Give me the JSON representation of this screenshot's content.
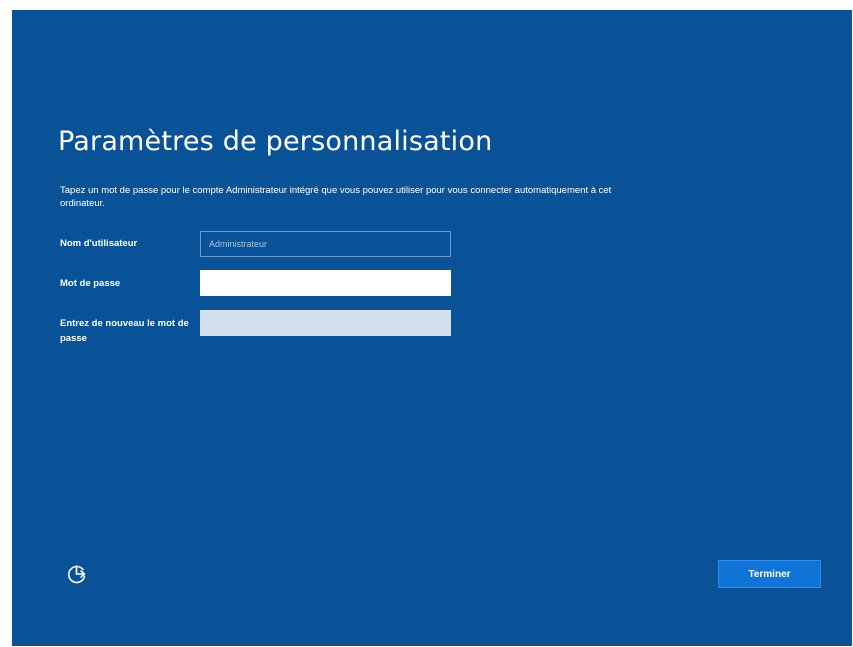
{
  "page": {
    "title": "Paramètres de personnalisation",
    "description": "Tapez un mot de passe pour le compte Administrateur intégré que vous pouvez utiliser pour vous connecter automatiquement à cet ordinateur."
  },
  "form": {
    "username": {
      "label": "Nom d'utilisateur",
      "placeholder": "Administrateur",
      "value": ""
    },
    "password": {
      "label": "Mot de passe",
      "value": ""
    },
    "confirm_password": {
      "label": "Entrez de nouveau le mot de passe",
      "value": ""
    }
  },
  "footer": {
    "accessibility_icon": "ease-of-access-icon",
    "finish_label": "Terminer"
  },
  "colors": {
    "background": "#0a5298",
    "button": "#0f74d6",
    "text": "#ffffff"
  }
}
